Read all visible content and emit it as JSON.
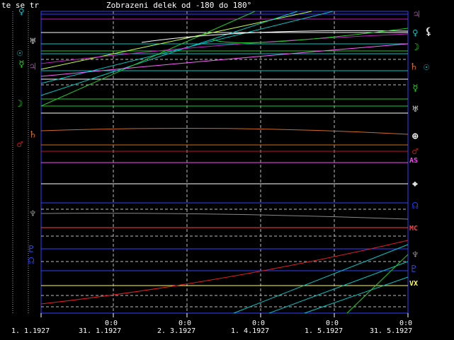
{
  "title": "Zobrazeni delek od -180 do 180°",
  "corner_label": "te se tr",
  "time_labels": [
    "0:0",
    "0:0",
    "0:0",
    "0:0",
    "0:0"
  ],
  "date_labels": [
    "1. 1.1927",
    "31. 1.1927",
    "2. 3.1927",
    "1. 4.1927",
    "1. 5.1927",
    "31. 5.1927"
  ],
  "left_glyphs": [
    {
      "symbol": "♀",
      "name": "venus",
      "color": "#00c8c8"
    },
    {
      "symbol": "☉",
      "name": "sun",
      "color": "#00c8c8"
    },
    {
      "symbol": "☿",
      "name": "mercury",
      "color": "#22cc22"
    },
    {
      "symbol": "☽",
      "name": "moon",
      "color": "#22cc22"
    },
    {
      "symbol": "♃",
      "name": "jupiter",
      "color": "#c020c0"
    },
    {
      "symbol": "♄",
      "name": "saturn",
      "color": "#d06a20"
    },
    {
      "symbol": "♂",
      "name": "mars",
      "color": "#c01818"
    },
    {
      "symbol": "♆",
      "name": "neptune",
      "color": "#888888"
    },
    {
      "symbol": "♇",
      "name": "pluto",
      "color": "#3050ff"
    },
    {
      "symbol": "♅",
      "name": "uranus",
      "color": "#dddddd"
    },
    {
      "symbol": "☊",
      "name": "node",
      "color": "#2040ff"
    }
  ],
  "right_labels": [
    {
      "text": "♃",
      "name": "jupiter",
      "color": "#c020c0"
    },
    {
      "text": "♀",
      "name": "venus",
      "color": "#00c8c8"
    },
    {
      "text": "⚸",
      "name": "lilith",
      "color": "#dddddd"
    },
    {
      "text": "☽",
      "name": "moon",
      "color": "#22cc22"
    },
    {
      "text": "♄",
      "name": "saturn",
      "color": "#d06a20"
    },
    {
      "text": "☉",
      "name": "sun",
      "color": "#00c8c8"
    },
    {
      "text": "☿",
      "name": "mercury",
      "color": "#22cc22"
    },
    {
      "text": "♅",
      "name": "uranus",
      "color": "#dddddd"
    },
    {
      "text": "⊕",
      "name": "earth",
      "color": "#ffffff"
    },
    {
      "text": "♂",
      "name": "mars",
      "color": "#c01818"
    },
    {
      "text": "AS",
      "name": "ascendant",
      "color": "#ff40ff"
    },
    {
      "text": "⌖",
      "name": "vertex-cross",
      "color": "#ffffff"
    },
    {
      "text": "☊",
      "name": "node",
      "color": "#2040ff"
    },
    {
      "text": "MC",
      "name": "midheaven",
      "color": "#ff4040"
    },
    {
      "text": "♆",
      "name": "neptune",
      "color": "#888888"
    },
    {
      "text": "♇",
      "name": "pluto",
      "color": "#3050ff"
    },
    {
      "text": "VX",
      "name": "vertex",
      "color": "#ffff40"
    }
  ],
  "colors": {
    "background": "#000000",
    "frame": "#ffffff",
    "grid": "#c0c0c0",
    "axis_blue": "#3040ff"
  }
}
